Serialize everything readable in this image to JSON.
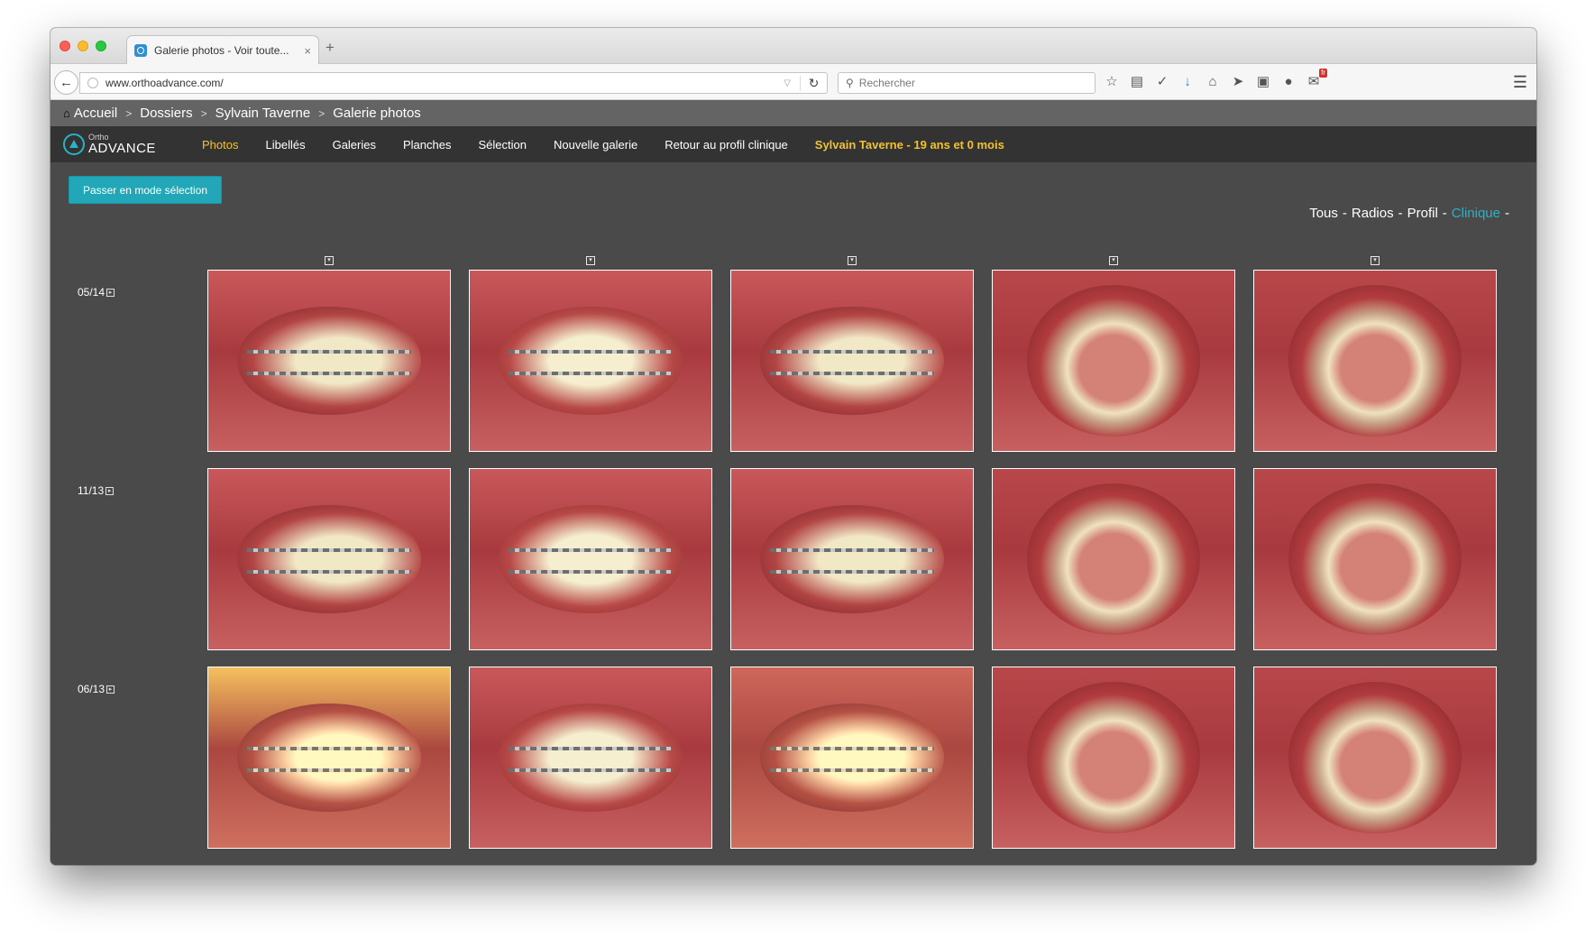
{
  "browser": {
    "tab_title": "Galerie photos - Voir toute...",
    "tab_close": "×",
    "new_tab": "+",
    "url": "www.orthoadvance.com/",
    "search_placeholder": "Rechercher",
    "notif_badge": "fr",
    "icons": [
      "star-icon",
      "reading-list-icon",
      "pocket-icon",
      "download-icon",
      "home-icon",
      "send-icon",
      "n-icon",
      "chat-icon",
      "notification-icon",
      "menu-icon"
    ]
  },
  "breadcrumb": {
    "items": [
      "Accueil",
      "Dossiers",
      "Sylvain Taverne",
      "Galerie photos"
    ],
    "separator": ">"
  },
  "logo": {
    "small": "Ortho",
    "big": "ADVANCE"
  },
  "nav": {
    "items": [
      "Photos",
      "Libellés",
      "Galeries",
      "Planches",
      "Sélection",
      "Nouvelle galerie",
      "Retour au profil clinique"
    ],
    "active_index": 0,
    "patient": "Sylvain Taverne - 19 ans et 0 mois"
  },
  "actions": {
    "select_mode": "Passer en mode sélection"
  },
  "filters": {
    "items": [
      "Tous",
      "Radios",
      "Profil",
      "Clinique"
    ],
    "separator": "-",
    "active": "Clinique"
  },
  "gallery": {
    "rows": [
      {
        "date": "05/14",
        "photos": [
          "side",
          "front",
          "side",
          "arch",
          "arch"
        ]
      },
      {
        "date": "11/13",
        "photos": [
          "side",
          "front",
          "side",
          "arch",
          "arch"
        ]
      },
      {
        "date": "06/13",
        "photos": [
          "side",
          "front",
          "side",
          "arch",
          "arch"
        ]
      }
    ]
  },
  "colors": {
    "accent": "#21a7b8",
    "highlight": "#f2c230",
    "nav_bg": "#333333",
    "content_bg": "#4a4a4a"
  }
}
